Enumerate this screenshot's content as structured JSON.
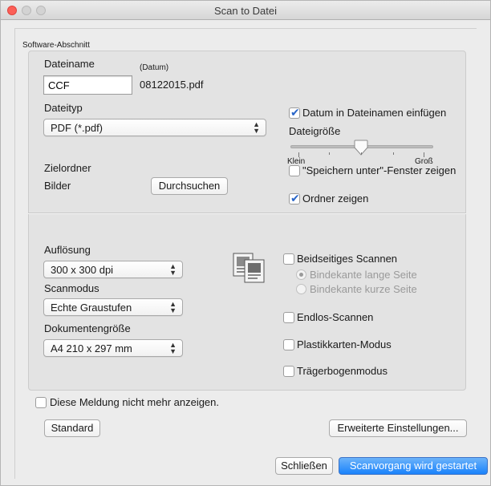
{
  "window": {
    "title": "Scan to Datei"
  },
  "section": "Software-Abschnitt",
  "filename": {
    "label": "Dateiname",
    "date_hint": "(Datum)",
    "value": "CCF",
    "date_value": "08122015.pdf"
  },
  "insert_date": {
    "label": "Datum in Dateinamen einfügen",
    "checked": true
  },
  "filetype": {
    "label": "Dateityp",
    "value": "PDF (*.pdf)"
  },
  "filesize": {
    "label": "Dateigröße",
    "min_label": "Klein",
    "max_label": "Groß",
    "level": 0.5
  },
  "destination": {
    "label": "Zielordner",
    "value": "Bilder",
    "browse_button": "Durchsuchen"
  },
  "save_as_dialog": {
    "label": "\"Speichern unter\"-Fenster zeigen",
    "checked": false
  },
  "show_folder": {
    "label": "Ordner zeigen",
    "checked": true
  },
  "resolution": {
    "label": "Auflösung",
    "value": "300 x 300 dpi"
  },
  "scan_mode": {
    "label": "Scanmodus",
    "value": "Echte Graustufen"
  },
  "doc_size": {
    "label": "Dokumentengröße",
    "value": "A4 210 x 297 mm"
  },
  "duplex": {
    "label": "Beidseitiges Scannen",
    "checked": false,
    "long_edge": "Bindekante lange Seite",
    "short_edge": "Bindekante kurze Seite"
  },
  "continuous": {
    "label": "Endlos-Scannen",
    "checked": false
  },
  "plastic_card": {
    "label": "Plastikkarten-Modus",
    "checked": false
  },
  "carrier_sheet": {
    "label": "Trägerbogenmodus",
    "checked": false
  },
  "dont_show": {
    "label": "Diese Meldung nicht mehr anzeigen.",
    "checked": false
  },
  "buttons": {
    "default": "Standard",
    "advanced": "Erweiterte Einstellungen...",
    "close": "Schließen",
    "start": "Scanvorgang wird gestartet"
  },
  "colors": {
    "accent": "#1a82fb",
    "check": "#2a66c8"
  }
}
